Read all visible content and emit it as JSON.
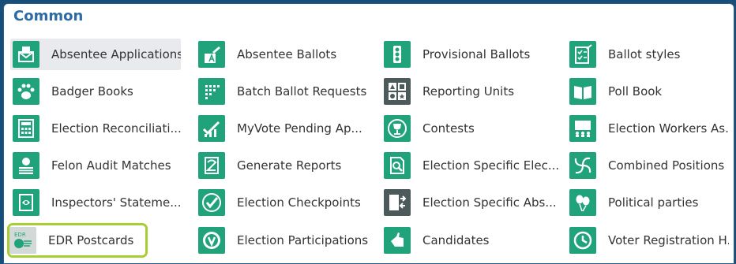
{
  "section": {
    "title": "Common"
  },
  "items": [
    {
      "label": "Absentee Applications",
      "icon": "envelope-form-icon",
      "color": "#20a37a"
    },
    {
      "label": "Absentee Ballots",
      "icon": "pencil-ballot-icon",
      "color": "#20a37a"
    },
    {
      "label": "Provisional Ballots",
      "icon": "traffic-light-icon",
      "color": "#20a37a"
    },
    {
      "label": "Ballot styles",
      "icon": "ballot-checklist-icon",
      "color": "#20a37a"
    },
    {
      "label": "Badger Books",
      "icon": "paw-print-icon",
      "color": "#20a37a"
    },
    {
      "label": "Batch Ballot Requests",
      "icon": "dot-grid-icon",
      "color": "#20a37a"
    },
    {
      "label": "Reporting Units",
      "icon": "shapes-grid-icon",
      "color": "#4d5a5b"
    },
    {
      "label": "Poll Book",
      "icon": "open-book-icon",
      "color": "#20a37a"
    },
    {
      "label": "Election Reconciliati...",
      "icon": "calculator-icon",
      "color": "#20a37a"
    },
    {
      "label": "MyVote Pending Ap...",
      "icon": "chart-checkmark-icon",
      "color": "#20a37a"
    },
    {
      "label": "Contests",
      "icon": "trophy-icon",
      "color": "#20a37a"
    },
    {
      "label": "Election Workers As...",
      "icon": "meeting-icon",
      "color": "#20a37a"
    },
    {
      "label": "Felon Audit Matches",
      "icon": "prisoner-icon",
      "color": "#20a37a"
    },
    {
      "label": "Generate Reports",
      "icon": "report-doc-icon",
      "color": "#20a37a"
    },
    {
      "label": "Election Specific Elec...",
      "icon": "magnifier-doc-icon",
      "color": "#20a37a"
    },
    {
      "label": "Combined Positions",
      "icon": "swirl-icon",
      "color": "#20a37a"
    },
    {
      "label": "Inspectors' Stateme...",
      "icon": "eye-doc-icon",
      "color": "#20a37a"
    },
    {
      "label": "Election Checkpoints",
      "icon": "checkmark-icon",
      "color": "#20a37a"
    },
    {
      "label": "Election Specific Abs...",
      "icon": "arrows-doc-icon",
      "color": "#4d5a5b"
    },
    {
      "label": "Political parties",
      "icon": "balloons-icon",
      "color": "#20a37a"
    },
    {
      "label": "EDR Postcards",
      "icon": "edr-postcard-icon",
      "color": "#d3d9d6",
      "badge": "EDR"
    },
    {
      "label": "Election Participations",
      "icon": "circle-v-icon",
      "color": "#20a37a"
    },
    {
      "label": "Candidates",
      "icon": "hand-vote-icon",
      "color": "#20a37a"
    },
    {
      "label": "Voter Registration H...",
      "icon": "clock-history-icon",
      "color": "#20a37a"
    }
  ]
}
